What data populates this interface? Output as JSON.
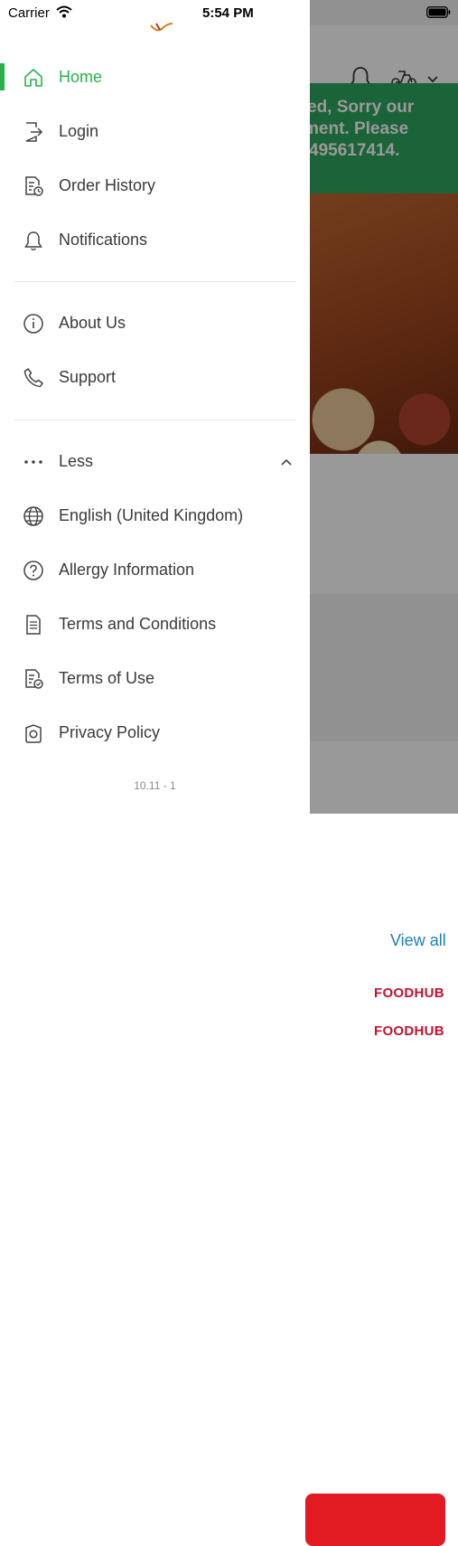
{
  "status_bar": {
    "carrier": "Carrier",
    "time": "5:54 PM"
  },
  "background": {
    "banner_lines": [
      "ed, Sorry our",
      "ment. Please",
      "495617414."
    ],
    "view_all": "View all",
    "brand_logos": [
      "FOODHUB",
      "FOODHUB"
    ]
  },
  "drawer": {
    "nav_items": [
      {
        "label": "Home",
        "icon": "home-icon",
        "active": true
      },
      {
        "label": "Login",
        "icon": "login-icon"
      },
      {
        "label": "Order History",
        "icon": "order-history-icon"
      },
      {
        "label": "Notifications",
        "icon": "bell-icon"
      }
    ],
    "info_items": [
      {
        "label": "About Us",
        "icon": "info-icon"
      },
      {
        "label": "Support",
        "icon": "phone-icon"
      }
    ],
    "less_label": "Less",
    "more_items": [
      {
        "label": "English (United Kingdom)",
        "icon": "globe-icon"
      },
      {
        "label": "Allergy Information",
        "icon": "question-icon"
      },
      {
        "label": "Terms and Conditions",
        "icon": "document-icon"
      },
      {
        "label": "Terms of Use",
        "icon": "document-check-icon"
      },
      {
        "label": "Privacy Policy",
        "icon": "privacy-icon"
      }
    ],
    "version": "10.11 - 1"
  },
  "colors": {
    "accent": "#26b24b",
    "banner": "#2ea55e",
    "brand_red": "#c8102e",
    "link_blue": "#1a7fb8"
  }
}
